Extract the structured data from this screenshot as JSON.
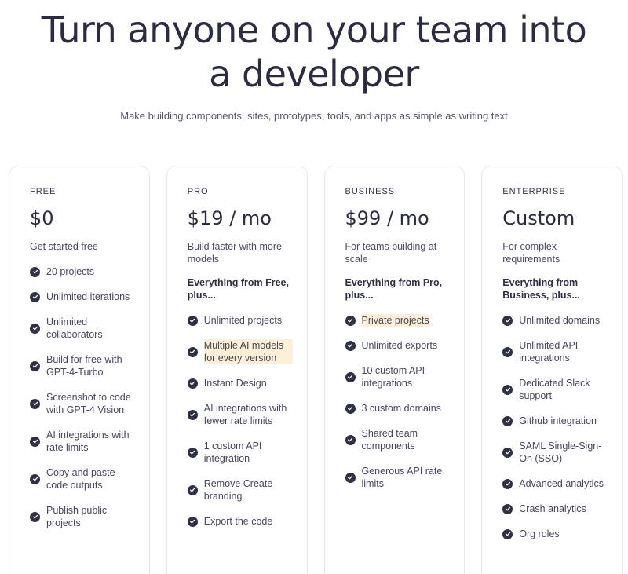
{
  "hero": {
    "title": "Turn anyone on your team into a developer",
    "subtitle": "Make building components, sites, prototypes, tools, and apps as simple as writing text"
  },
  "colors": {
    "text_dark": "#2b2c42",
    "check_fill": "#2e3044",
    "highlight": "#fdf0d6",
    "card_border": "#e8e8ee"
  },
  "plans": [
    {
      "tier": "FREE",
      "price": "$0",
      "desc": "Get started free",
      "includes": "",
      "features": [
        {
          "label": "20 projects",
          "highlight": false
        },
        {
          "label": "Unlimited iterations",
          "highlight": false
        },
        {
          "label": "Unlimited collaborators",
          "highlight": false
        },
        {
          "label": "Build for free with GPT-4-Turbo",
          "highlight": false
        },
        {
          "label": "Screenshot to code with GPT-4 Vision",
          "highlight": false
        },
        {
          "label": "AI integrations with rate limits",
          "highlight": false
        },
        {
          "label": "Copy and paste code outputs",
          "highlight": false
        },
        {
          "label": "Publish public projects",
          "highlight": false
        }
      ]
    },
    {
      "tier": "PRO",
      "price": "$19 / mo",
      "desc": "Build faster with more models",
      "includes": "Everything from Free, plus...",
      "features": [
        {
          "label": "Unlimited projects",
          "highlight": false
        },
        {
          "label": "Multiple AI models for every version",
          "highlight": true
        },
        {
          "label": "Instant Design",
          "highlight": false
        },
        {
          "label": "AI integrations with fewer rate limits",
          "highlight": false
        },
        {
          "label": "1 custom API integration",
          "highlight": false
        },
        {
          "label": "Remove Create branding",
          "highlight": false
        },
        {
          "label": "Export the code",
          "highlight": false
        }
      ]
    },
    {
      "tier": "BUSINESS",
      "price": "$99 / mo",
      "desc": "For teams building at scale",
      "includes": "Everything from Pro, plus...",
      "features": [
        {
          "label": "Private projects",
          "highlight": true
        },
        {
          "label": "Unlimited exports",
          "highlight": false
        },
        {
          "label": "10 custom API integrations",
          "highlight": false
        },
        {
          "label": "3 custom domains",
          "highlight": false
        },
        {
          "label": "Shared team components",
          "highlight": false
        },
        {
          "label": "Generous API rate limits",
          "highlight": false
        }
      ]
    },
    {
      "tier": "ENTERPRISE",
      "price": "Custom",
      "desc": "For complex requirements",
      "includes": "Everything from Business, plus...",
      "features": [
        {
          "label": "Unlimited domains",
          "highlight": false
        },
        {
          "label": "Unlimited API integrations",
          "highlight": false
        },
        {
          "label": "Dedicated Slack support",
          "highlight": false
        },
        {
          "label": "Github integration",
          "highlight": false
        },
        {
          "label": "SAML Single-Sign-On (SSO)",
          "highlight": false
        },
        {
          "label": "Advanced analytics",
          "highlight": false
        },
        {
          "label": "Crash analytics",
          "highlight": false
        },
        {
          "label": "Org roles",
          "highlight": false
        }
      ]
    }
  ]
}
